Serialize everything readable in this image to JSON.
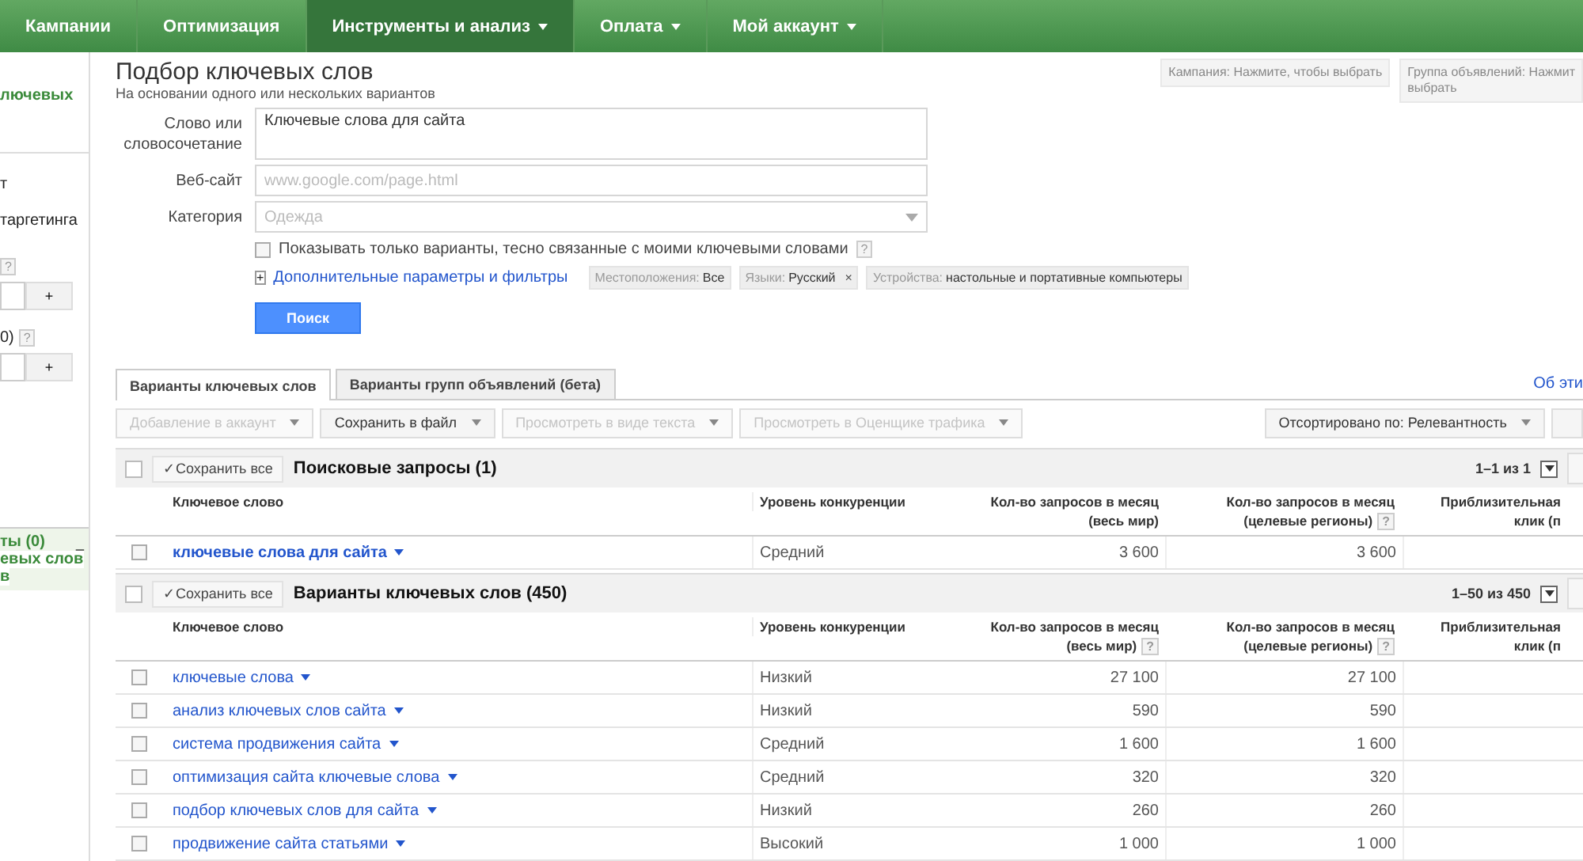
{
  "nav": [
    {
      "label": "Кампании",
      "selected": false,
      "menu": false
    },
    {
      "label": "Оптимизация",
      "selected": false,
      "menu": false
    },
    {
      "label": "Инструменты и анализ",
      "selected": true,
      "menu": true
    },
    {
      "label": "Оплата",
      "selected": false,
      "menu": true
    },
    {
      "label": "Мой аккаунт",
      "selected": false,
      "menu": true
    }
  ],
  "sidebar": {
    "top_link": "лючевых",
    "texts": [
      "т",
      "таргетинга"
    ],
    "fields": [
      {
        "help": "?",
        "button": "+"
      },
      {
        "label": "0)",
        "help": "?",
        "button": "+"
      }
    ],
    "panel": {
      "title": "ты (0)",
      "collapse": "_",
      "lines": [
        "евых слов",
        "в"
      ]
    }
  },
  "page": {
    "title": "Подбор ключевых слов",
    "subtitle": "На основании одного или нескольких вариантов"
  },
  "pickers": [
    {
      "lines": [
        "Кампания: Нажмите, чтобы выбрать"
      ]
    },
    {
      "lines": [
        "Группа объявлений: Нажмит",
        "выбрать"
      ]
    }
  ],
  "form": {
    "fields": [
      {
        "kind": "textarea",
        "label": "Слово или словосочетание",
        "value": "Ключевые слова для сайта"
      },
      {
        "kind": "input",
        "label": "Веб-сайт",
        "placeholder": "www.google.com/page.html"
      },
      {
        "kind": "select",
        "label": "Категория",
        "placeholder": "Одежда"
      }
    ],
    "checkbox": {
      "label": "Показывать только варианты, тесно связанные с моими ключевыми словами",
      "checked": false,
      "help": "?"
    },
    "filters": {
      "expand": "+",
      "link": "Дополнительные параметры и фильтры",
      "chips": [
        {
          "key": "Местоположения:",
          "value": "Все"
        },
        {
          "key": "Языки:",
          "value": "Русский",
          "remove": "×"
        },
        {
          "key": "Устройства:",
          "value": "настольные и портативные компьютеры"
        }
      ]
    },
    "search_button": "Поиск"
  },
  "tabs": [
    {
      "label": "Варианты ключевых слов",
      "selected": true
    },
    {
      "label": "Варианты групп объявлений (бета)",
      "selected": false
    }
  ],
  "about_link": "Об эти",
  "toolbar": {
    "buttons": [
      {
        "label": "Добавление в аккаунт",
        "disabled": true
      },
      {
        "label": "Сохранить в файл",
        "disabled": false
      },
      {
        "label": "Просмотреть в виде текста",
        "disabled": true
      },
      {
        "label": "Просмотреть в Оценщике трафика",
        "disabled": true
      }
    ],
    "sort": "Отсортировано по: Релевантность"
  },
  "sections": [
    {
      "save_all": "✓Сохранить все",
      "title": "Поисковые запросы (1)",
      "paging": "1–1 из 1",
      "emphasis": true,
      "columns": [
        {
          "label": "Ключевое слово"
        },
        {
          "label": "Уровень конкуренции"
        },
        {
          "label": "Кол-во запросов в месяц\n(весь мир)"
        },
        {
          "label": "Кол-во запросов в месяц\n(целевые регионы)",
          "help": "?"
        },
        {
          "label": "Приблизительная\nклик (п"
        }
      ],
      "rows": [
        {
          "keyword": "ключевые слова для сайта",
          "competition": "Средний",
          "world": "3 600",
          "regional": "3 600",
          "checked": false
        }
      ]
    },
    {
      "save_all": "✓Сохранить все",
      "title": "Варианты ключевых слов (450)",
      "paging": "1–50 из 450",
      "emphasis": false,
      "columns": [
        {
          "label": "Ключевое слово"
        },
        {
          "label": "Уровень конкуренции"
        },
        {
          "label": "Кол-во запросов в месяц\n(весь мир)",
          "help": "?"
        },
        {
          "label": "Кол-во запросов в месяц\n(целевые регионы)",
          "help": "?"
        },
        {
          "label": "Приблизительная\nклик (п"
        }
      ],
      "rows": [
        {
          "keyword": "ключевые слова",
          "competition": "Низкий",
          "world": "27 100",
          "regional": "27 100",
          "checked": false
        },
        {
          "keyword": "анализ ключевых слов сайта",
          "competition": "Низкий",
          "world": "590",
          "regional": "590",
          "checked": false
        },
        {
          "keyword": "система продвижения сайта",
          "competition": "Средний",
          "world": "1 600",
          "regional": "1 600",
          "checked": false
        },
        {
          "keyword": "оптимизация сайта ключевые слова",
          "competition": "Средний",
          "world": "320",
          "regional": "320",
          "checked": false
        },
        {
          "keyword": "подбор ключевых слов для сайта",
          "competition": "Низкий",
          "world": "260",
          "regional": "260",
          "checked": false
        },
        {
          "keyword": "продвижение сайта статьями",
          "competition": "Высокий",
          "world": "1 000",
          "regional": "1 000",
          "checked": false
        }
      ]
    }
  ]
}
